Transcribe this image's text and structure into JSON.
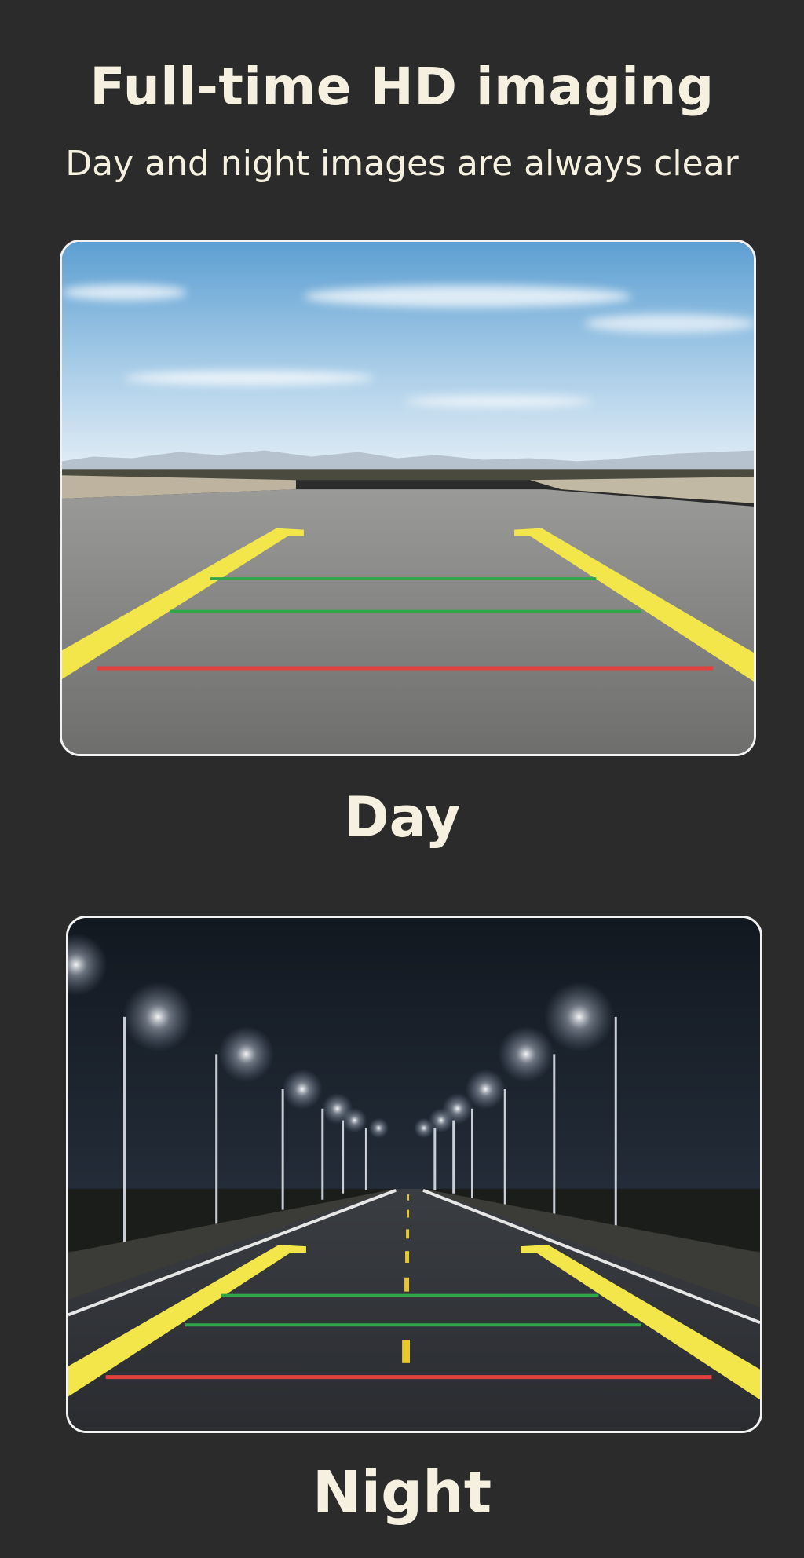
{
  "header": {
    "title": "Full-time HD imaging",
    "subtitle": "Day and night images are always clear"
  },
  "panels": {
    "day": {
      "caption": "Day"
    },
    "night": {
      "caption": "Night"
    }
  },
  "colors": {
    "background": "#2b2b2b",
    "text": "#f5f0df",
    "guide_yellow": "#f2e64a",
    "guide_green": "#2fa64a",
    "guide_red": "#e04040"
  }
}
